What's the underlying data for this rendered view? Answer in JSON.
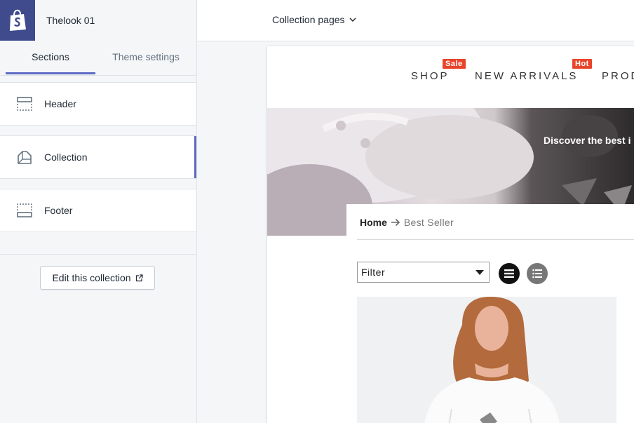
{
  "app": {
    "store_name": "Thelook 01",
    "brand_color": "#3f4b8c",
    "accent_color": "#5c6ac4"
  },
  "sidebar": {
    "tabs": [
      {
        "label": "Sections",
        "active": true
      },
      {
        "label": "Theme settings",
        "active": false
      }
    ],
    "sections": [
      {
        "label": "Header",
        "icon": "header-layout-icon"
      },
      {
        "label": "Collection",
        "icon": "collection-layout-icon",
        "active": true
      },
      {
        "label": "Footer",
        "icon": "footer-layout-icon"
      }
    ],
    "edit_button": {
      "label": "Edit this collection",
      "icon": "external-link-icon"
    }
  },
  "topbar": {
    "page_select": "Collection pages",
    "icon": "chevron-down-icon"
  },
  "preview": {
    "nav": [
      {
        "label": "SHOP",
        "badge": "Sale"
      },
      {
        "label": "NEW ARRIVALS",
        "badge": "Hot"
      },
      {
        "label": "PROD",
        "badge": ""
      }
    ],
    "badge_color": "#e9442a",
    "banner_text": "Discover the best i",
    "breadcrumb": {
      "home": "Home",
      "separator_icon": "arrow-right-icon",
      "current": "Best Seller"
    },
    "filter": {
      "value": "Filter"
    },
    "view_toggles": [
      {
        "icon": "grid-view-icon",
        "active": true
      },
      {
        "icon": "list-view-icon",
        "active": false
      }
    ]
  }
}
